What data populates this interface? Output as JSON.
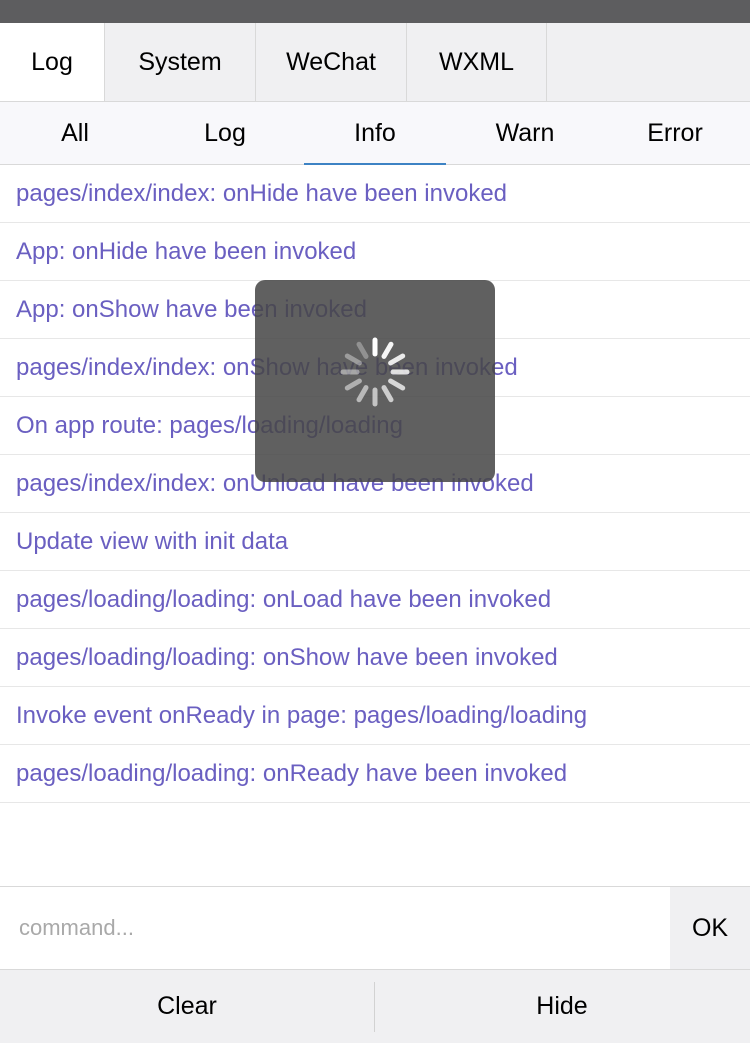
{
  "tabs": [
    {
      "label": "Log",
      "active": true
    },
    {
      "label": "System",
      "active": false
    },
    {
      "label": "WeChat",
      "active": false
    },
    {
      "label": "WXML",
      "active": false
    }
  ],
  "filters": [
    {
      "label": "All",
      "active": false
    },
    {
      "label": "Log",
      "active": false
    },
    {
      "label": "Info",
      "active": true
    },
    {
      "label": "Warn",
      "active": false
    },
    {
      "label": "Error",
      "active": false
    }
  ],
  "log_entries": [
    "pages/index/index: onHide have been invoked",
    "App: onHide have been invoked",
    "App: onShow have been invoked",
    "pages/index/index: onShow have been invoked",
    "On app route: pages/loading/loading",
    "pages/index/index: onUnload have been invoked",
    "Update view with init data",
    "pages/loading/loading: onLoad have been invoked",
    "pages/loading/loading: onShow have been invoked",
    "Invoke event onReady in page: pages/loading/loading",
    "pages/loading/loading: onReady have been invoked"
  ],
  "command": {
    "placeholder": "command...",
    "value": "",
    "ok_label": "OK"
  },
  "footer": {
    "clear_label": "Clear",
    "hide_label": "Hide"
  },
  "colors": {
    "log_text": "#6a5fc1",
    "active_underline": "#3d83c4",
    "toast_bg": "#464646"
  },
  "loading_toast": {
    "icon": "loading-spinner-icon"
  }
}
